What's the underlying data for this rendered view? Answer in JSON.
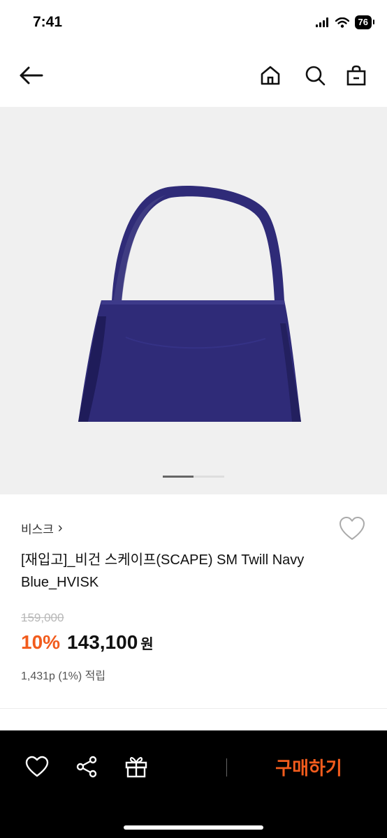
{
  "status_bar": {
    "time": "7:41",
    "battery": "76"
  },
  "product": {
    "brand": "비스크",
    "brand_chevron": "›",
    "title": "[재입고]_비건 스케이프(SCAPE) SM Twill Navy Blue_HVISK",
    "original_price": "159,000",
    "discount": "10%",
    "sale_price": "143,100",
    "currency": "원",
    "points": "1,431p (1%) 적립",
    "image_page": {
      "current": 1,
      "total": 2
    }
  },
  "bottom_bar": {
    "buy_label": "구매하기"
  },
  "icons": {
    "back": "arrow-left-icon",
    "home": "home-icon",
    "search": "search-icon",
    "bag": "shopping-bag-icon",
    "wish": "heart-icon",
    "share": "share-icon",
    "gift": "gift-icon"
  },
  "colors": {
    "accent": "#f25c1d",
    "bag": "#2f2b78",
    "bottom_bar": "#000000"
  }
}
